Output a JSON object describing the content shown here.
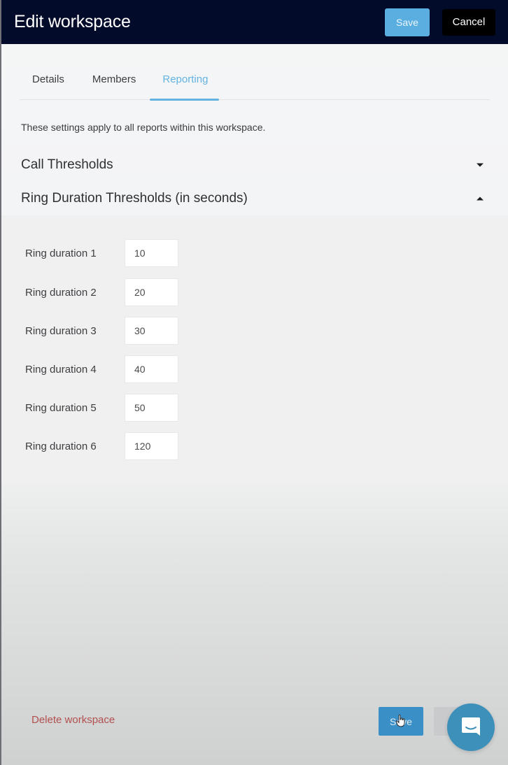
{
  "header": {
    "title": "Edit workspace",
    "save_label": "Save",
    "cancel_label": "Cancel"
  },
  "tabs": [
    {
      "label": "Details",
      "active": false
    },
    {
      "label": "Members",
      "active": false
    },
    {
      "label": "Reporting",
      "active": true
    }
  ],
  "intro_text": "These settings apply to all reports within this workspace.",
  "sections": [
    {
      "title": "Call Thresholds",
      "expanded": false,
      "icon": "caret-down-icon"
    },
    {
      "title": "Ring Duration Thresholds (in seconds)",
      "expanded": true,
      "icon": "caret-up-icon"
    }
  ],
  "ring_durations": [
    {
      "label": "Ring duration 1",
      "value": "10"
    },
    {
      "label": "Ring duration 2",
      "value": "20"
    },
    {
      "label": "Ring duration 3",
      "value": "30"
    },
    {
      "label": "Ring duration 4",
      "value": "40"
    },
    {
      "label": "Ring duration 5",
      "value": "50"
    },
    {
      "label": "Ring duration 6",
      "value": "120"
    }
  ],
  "footer": {
    "delete_label": "Delete workspace",
    "save_label": "Save"
  },
  "colors": {
    "header_bg": "#030b2a",
    "accent": "#63b3e2",
    "save_primary": "#5aaee0",
    "danger": "#b2504f",
    "chat_bubble": "#3d90b9"
  }
}
